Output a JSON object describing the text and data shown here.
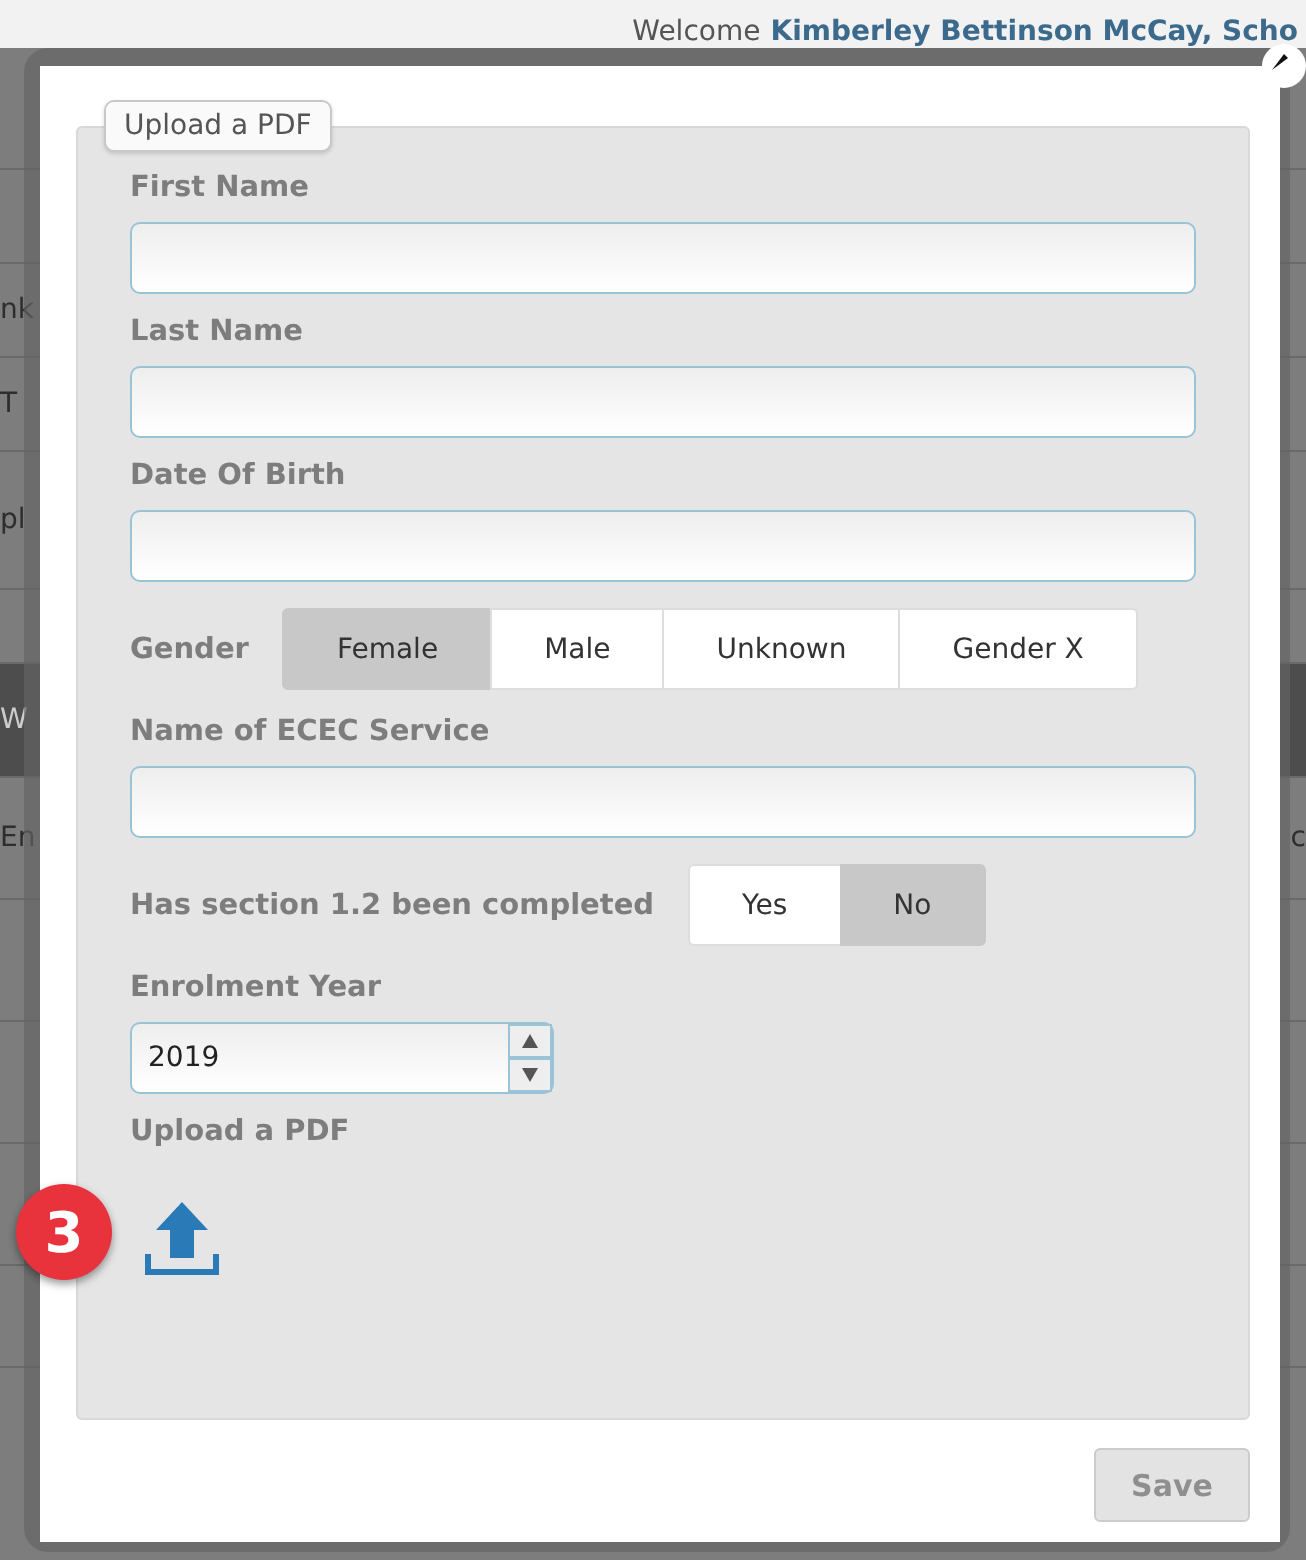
{
  "backdrop": {
    "welcome": "Welcome",
    "user": "Kimberley Bettinson McCay, Scho",
    "left_fragments": [
      "nk",
      "T",
      "pl",
      "W",
      "En"
    ],
    "right_fragment": "c"
  },
  "dialog": {
    "legend": "Upload a PDF",
    "fields": [
      {
        "kind": "text",
        "label": "First Name"
      },
      {
        "kind": "text",
        "label": "Last Name"
      },
      {
        "kind": "text",
        "label": "Date Of Birth"
      },
      {
        "kind": "segmented",
        "label": "Gender",
        "options": [
          {
            "label": "Female",
            "selected": true
          },
          {
            "label": "Male",
            "selected": false
          },
          {
            "label": "Unknown",
            "selected": false
          },
          {
            "label": "Gender X",
            "selected": false
          }
        ]
      },
      {
        "kind": "text",
        "label": "Name of ECEC Service"
      },
      {
        "kind": "segmented",
        "label": "Has section 1.2 been completed",
        "options": [
          {
            "label": "Yes",
            "selected": false
          },
          {
            "label": "No",
            "selected": true
          }
        ]
      },
      {
        "kind": "spinner",
        "label": "Enrolment Year",
        "value": "2019"
      },
      {
        "kind": "upload",
        "label": "Upload a PDF",
        "badge": "3"
      }
    ],
    "save": {
      "label": "Save",
      "disabled": true
    }
  }
}
